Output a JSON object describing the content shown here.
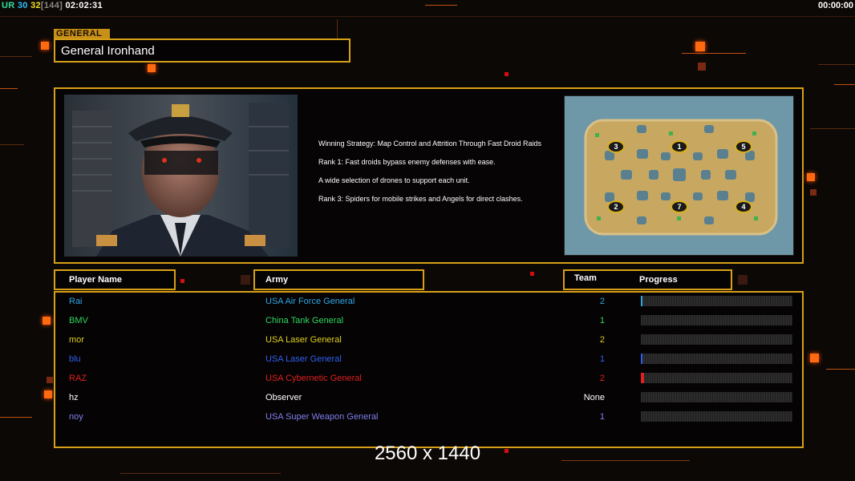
{
  "hud": {
    "left_label": "UR",
    "num_a": "30",
    "num_b": "32",
    "bracket": "[144]",
    "game_time": "02:02:31",
    "right_time": "00:00:00"
  },
  "general": {
    "tag": "GENERAL",
    "name": "General Ironhand"
  },
  "strategy": {
    "line1": "Winning Strategy: Map Control and Attrition Through Fast Droid Raids",
    "line2": "Rank 1: Fast droids bypass enemy defenses with ease.",
    "line3": "A wide selection of drones to support each unit.",
    "line4": "Rank 3: Spiders for mobile strikes and Angels for direct clashes."
  },
  "minimap": {
    "start_positions": [
      "3",
      "1",
      "5",
      "2",
      "7",
      "4"
    ]
  },
  "headers": {
    "player_name": "Player Name",
    "army": "Army",
    "team": "Team",
    "progress": "Progress"
  },
  "players": [
    {
      "name": "Rai",
      "army": "USA Air Force General",
      "team": "2",
      "color": "#2fa8e8",
      "progress": 0.01
    },
    {
      "name": "BMV",
      "army": "China Tank General",
      "team": "1",
      "color": "#30d860",
      "progress": 0.0
    },
    {
      "name": "mor",
      "army": "USA Laser General",
      "team": "2",
      "color": "#e0d020",
      "progress": 0.0
    },
    {
      "name": "blu",
      "army": "USA Laser General",
      "team": "1",
      "color": "#3060f0",
      "progress": 0.01
    },
    {
      "name": "RAZ",
      "army": "USA Cybernetic General",
      "team": "2",
      "color": "#e02020",
      "progress": 0.02
    },
    {
      "name": "hz",
      "army": "Observer",
      "team": "None",
      "color": "#ffffff",
      "progress": 0.0
    },
    {
      "name": "noy",
      "army": "USA Super Weapon General",
      "team": "1",
      "color": "#8080f0",
      "progress": 0.0
    }
  ],
  "footer": {
    "resolution": "2560 x 1440"
  },
  "colors": {
    "accent": "#d8a018",
    "hud_green": "#30e060",
    "hud_cyan": "#30c0ff",
    "hud_yellow": "#f0e020"
  }
}
